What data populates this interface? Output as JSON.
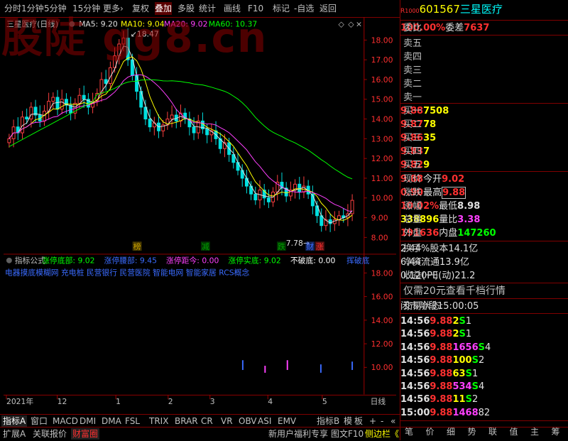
{
  "toolbar": {
    "items": [
      "分时",
      "1分钟",
      "5分钟",
      "15分钟",
      "更多›",
      "复权",
      "叠加",
      "多股",
      "统计",
      "画线",
      "F10",
      "标记",
      "-自选",
      "返回"
    ]
  },
  "watermark": "股陡 gg8.cn",
  "chart_header": {
    "title": "三星医疗(日线)",
    "ma5": "MA5: 9.20",
    "ma10": "MA10: 9.04",
    "ma20": "MA20: 9.02",
    "ma60": "MA60: 10.37",
    "high_label": "18.47",
    "low_label": "7.78"
  },
  "markers": [
    "榜",
    "减",
    "跌",
    "财",
    "涨"
  ],
  "indicator": {
    "line1": [
      {
        "text": "指标公式",
        "color": "#c0c0c0"
      },
      {
        "text": "涨停底部: 9.02",
        "color": "#00ff00"
      },
      {
        "text": "涨停腰部: 9.45",
        "color": "#3a6bff"
      },
      {
        "text": "涨停距今: 0.00",
        "color": "#ff40ff"
      },
      {
        "text": "涨停实底: 9.02",
        "color": "#00ff00"
      },
      {
        "text": "不破底: 0.00",
        "color": "#ffffff"
      },
      {
        "text": "挥破底",
        "color": "#3a6bff"
      }
    ],
    "line2": "电器摸底模糊网 充电桩 民营银行 民营医院 智能电网 智能家居 RCS概念"
  },
  "xaxis": {
    "labels": [
      "2021年",
      "12",
      "1",
      "2",
      "3",
      "4",
      "5"
    ],
    "right": "日线"
  },
  "chart_data": [
    {
      "type": "candlestick",
      "title": "三星医疗(日线)",
      "series": [
        {
          "name": "MA5",
          "value": 9.2
        },
        {
          "name": "MA10",
          "value": 9.04
        },
        {
          "name": "MA20",
          "value": 9.02
        },
        {
          "name": "MA60",
          "value": 10.37
        }
      ],
      "annotations": [
        {
          "text": "18.47",
          "kind": "high"
        },
        {
          "text": "7.78",
          "kind": "low"
        }
      ],
      "yticks": [
        18.0,
        17.0,
        16.0,
        15.0,
        14.0,
        13.0,
        12.0,
        11.0,
        10.0,
        9.0,
        8.0
      ],
      "ylim": [
        7.5,
        19.2
      ]
    },
    {
      "type": "bar",
      "title": "指标公式",
      "yticks": [
        18.0,
        16.0,
        14.0,
        12.0,
        10.0
      ],
      "ylim": [
        8.5,
        19
      ]
    }
  ],
  "panel": {
    "code_prefix": "R",
    "code_sub": "1000",
    "code": "601567",
    "name": "三星医疗",
    "weibi_label": "委比",
    "weibi": "100.00%",
    "weicha_label": "委差",
    "weicha": "7637",
    "sells": [
      {
        "label": "卖五",
        "price": "",
        "vol": ""
      },
      {
        "label": "卖四",
        "price": "",
        "vol": ""
      },
      {
        "label": "卖三",
        "price": "",
        "vol": ""
      },
      {
        "label": "卖二",
        "price": "",
        "vol": ""
      },
      {
        "label": "卖一",
        "price": "",
        "vol": ""
      }
    ],
    "buys": [
      {
        "label": "买一",
        "price": "9.88",
        "vol": "7508"
      },
      {
        "label": "买二",
        "price": "9.87",
        "vol": "78"
      },
      {
        "label": "买三",
        "price": "9.86",
        "vol": "35"
      },
      {
        "label": "买四",
        "price": "9.83",
        "vol": "7"
      },
      {
        "label": "买五",
        "price": "9.82",
        "vol": "9"
      }
    ],
    "stats": [
      {
        "l1": "现价",
        "v1": "9.88",
        "c1": "red",
        "l2": "今开",
        "v2": "9.02",
        "c2": "red"
      },
      {
        "l1": "涨跌",
        "v1": "0.90",
        "c1": "red",
        "l2": "最高",
        "v2": "9.88",
        "c2": "red"
      },
      {
        "l1": "涨幅",
        "v1": "10.02%",
        "c1": "red",
        "l2": "最低",
        "v2": "8.98",
        "c2": "wht"
      },
      {
        "l1": "总量",
        "v1": "338896",
        "c1": "yel",
        "l2": "量比",
        "v2": "3.38",
        "c2": "mag"
      },
      {
        "l1": "外盘",
        "v1": "191636",
        "c1": "red",
        "l2": "内盘",
        "v2": "147260",
        "c2": "grn"
      }
    ],
    "stats2": [
      {
        "l1": "换手",
        "v1": "2.44%",
        "l2": "股本",
        "v2": "14.1亿"
      },
      {
        "l1": "净资",
        "v1": "6.44",
        "l2": "流通",
        "v2": "13.9亿"
      },
      {
        "l1": "收益(一)",
        "v1": "0.120",
        "l2": "PE(动)",
        "v2": "21.2"
      }
    ],
    "promo": "仅需20元查看千档行情",
    "status_label": "交易状态:",
    "status_value": "闭市阶段",
    "status_time": "15:00:05",
    "trades": [
      {
        "t": "14:56",
        "p": "9.88",
        "v": "2",
        "vc": "yel",
        "d": "S",
        "n": "1"
      },
      {
        "t": "14:56",
        "p": "9.88",
        "v": "2",
        "vc": "yel",
        "d": "S",
        "n": "1"
      },
      {
        "t": "14:56",
        "p": "9.88",
        "v": "1656",
        "vc": "mag",
        "d": "S",
        "n": "4"
      },
      {
        "t": "14:56",
        "p": "9.88",
        "v": "100",
        "vc": "yel",
        "d": "S",
        "n": "2"
      },
      {
        "t": "14:56",
        "p": "9.88",
        "v": "63",
        "vc": "yel",
        "d": "S",
        "n": "1"
      },
      {
        "t": "14:56",
        "p": "9.88",
        "v": "534",
        "vc": "mag",
        "d": "S",
        "n": "4"
      },
      {
        "t": "14:56",
        "p": "9.88",
        "v": "11",
        "vc": "yel",
        "d": "S",
        "n": "2"
      },
      {
        "t": "15:00",
        "p": "9.88",
        "v": "1468",
        "vc": "mag",
        "d": "",
        "n": "82"
      }
    ],
    "bottom_tabs": [
      "笔",
      "价",
      "细",
      "势",
      "联",
      "值",
      "主",
      "筹"
    ]
  },
  "indicator_tabs": [
    "指标A",
    "窗口",
    "MACD",
    "DMI",
    "DMA",
    "FSL",
    "TRIX",
    "BRAR",
    "CR",
    "VR",
    "OBV",
    "ASI",
    "EMV"
  ],
  "indicator_tabs_right": [
    "指标B",
    "模",
    "板",
    "+",
    "-",
    "«"
  ],
  "bottom_bar": [
    "扩展A",
    "关联报价",
    "财富圈"
  ],
  "bottom_bar_right": [
    "新用户福利专享",
    "图文F10",
    "侧边栏《"
  ]
}
